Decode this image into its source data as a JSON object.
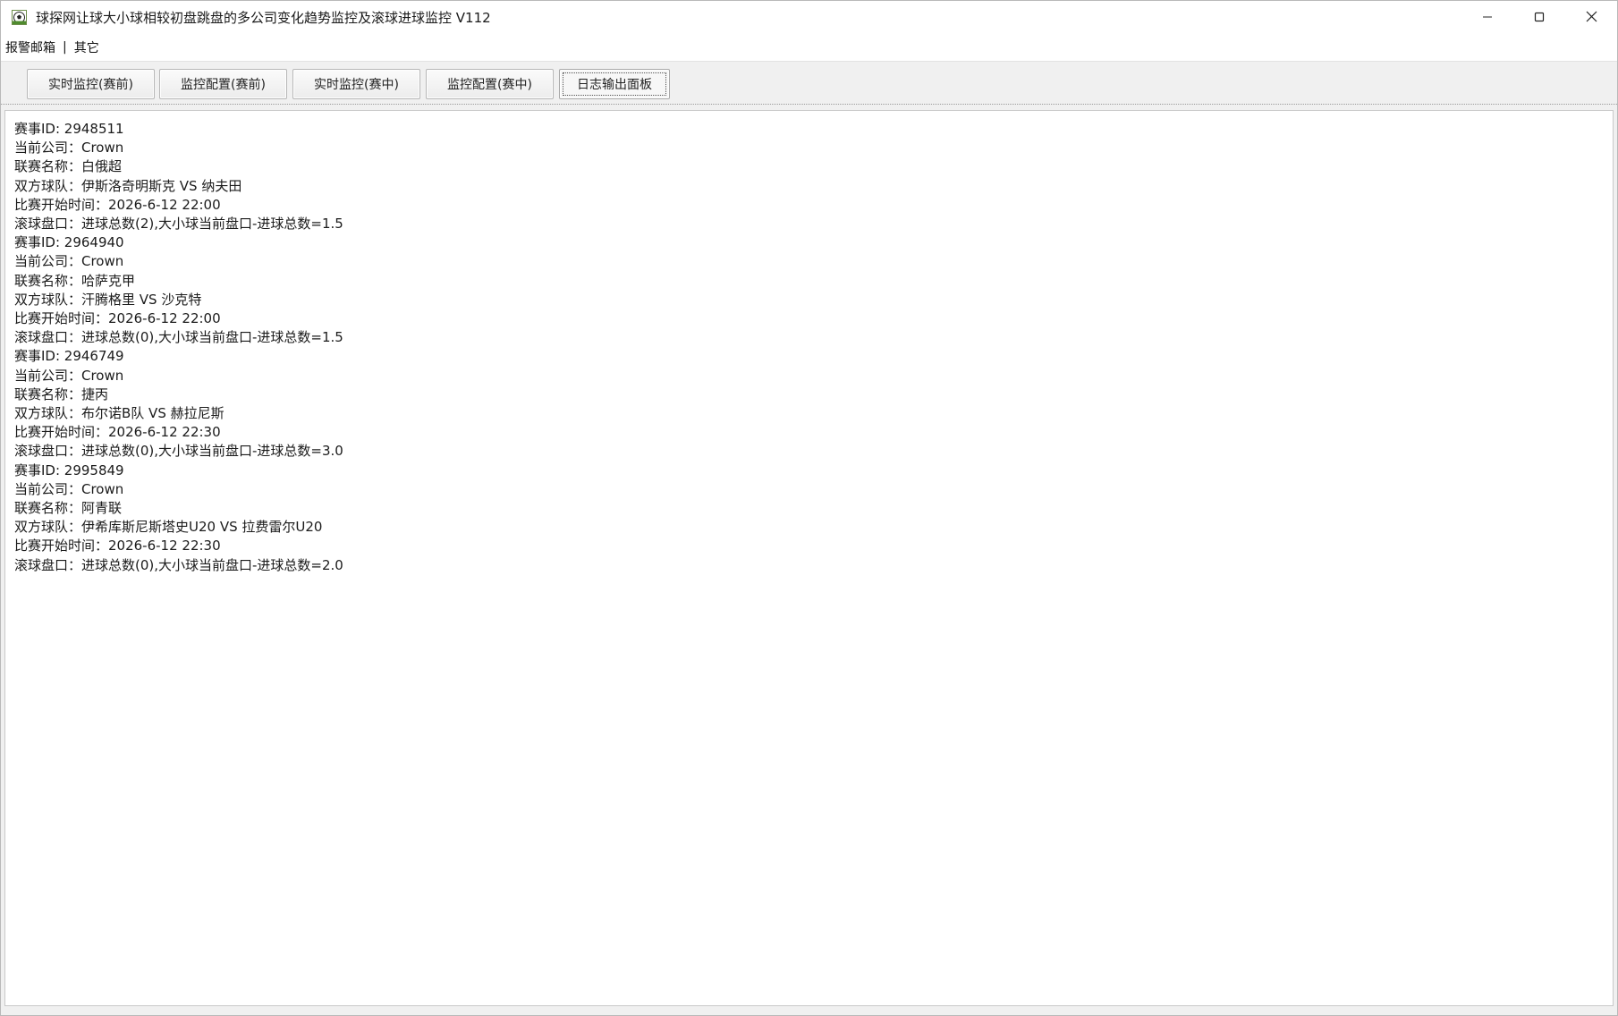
{
  "window": {
    "title": "球探网让球大小球相较初盘跳盘的多公司变化趋势监控及滚球进球监控 V112",
    "app_icon": "soccer-ball-icon",
    "controls": [
      "minimize-icon",
      "maximize-icon",
      "close-icon"
    ]
  },
  "menu": {
    "items": [
      "报警邮箱",
      "其它"
    ],
    "separator": "|"
  },
  "tabs": [
    {
      "label": "实时监控(赛前)",
      "active": false
    },
    {
      "label": "监控配置(赛前)",
      "active": false
    },
    {
      "label": "实时监控(赛中)",
      "active": false
    },
    {
      "label": "监控配置(赛中)",
      "active": false
    },
    {
      "label": "日志输出面板",
      "active": true
    }
  ],
  "log": {
    "lines": [
      "赛事ID: 2948511",
      "当前公司：Crown",
      "联赛名称：白俄超",
      "双方球队：伊斯洛奇明斯克 VS 纳夫田",
      "比赛开始时间：2026-6-12 22:00",
      "滚球盘口：进球总数(2),大小球当前盘口-进球总数=1.5",
      "赛事ID: 2964940",
      "当前公司：Crown",
      "联赛名称：哈萨克甲",
      "双方球队：汗腾格里 VS 沙克特",
      "比赛开始时间：2026-6-12 22:00",
      "滚球盘口：进球总数(0),大小球当前盘口-进球总数=1.5",
      "赛事ID: 2946749",
      "当前公司：Crown",
      "联赛名称：捷丙",
      "双方球队：布尔诺B队 VS 赫拉尼斯",
      "比赛开始时间：2026-6-12 22:30",
      "滚球盘口：进球总数(0),大小球当前盘口-进球总数=3.0",
      "赛事ID: 2995849",
      "当前公司：Crown",
      "联赛名称：阿青联",
      "双方球队：伊希库斯尼斯塔史U20 VS 拉费雷尔U20",
      "比赛开始时间：2026-6-12 22:30",
      "滚球盘口：进球总数(0),大小球当前盘口-进球总数=2.0"
    ]
  }
}
